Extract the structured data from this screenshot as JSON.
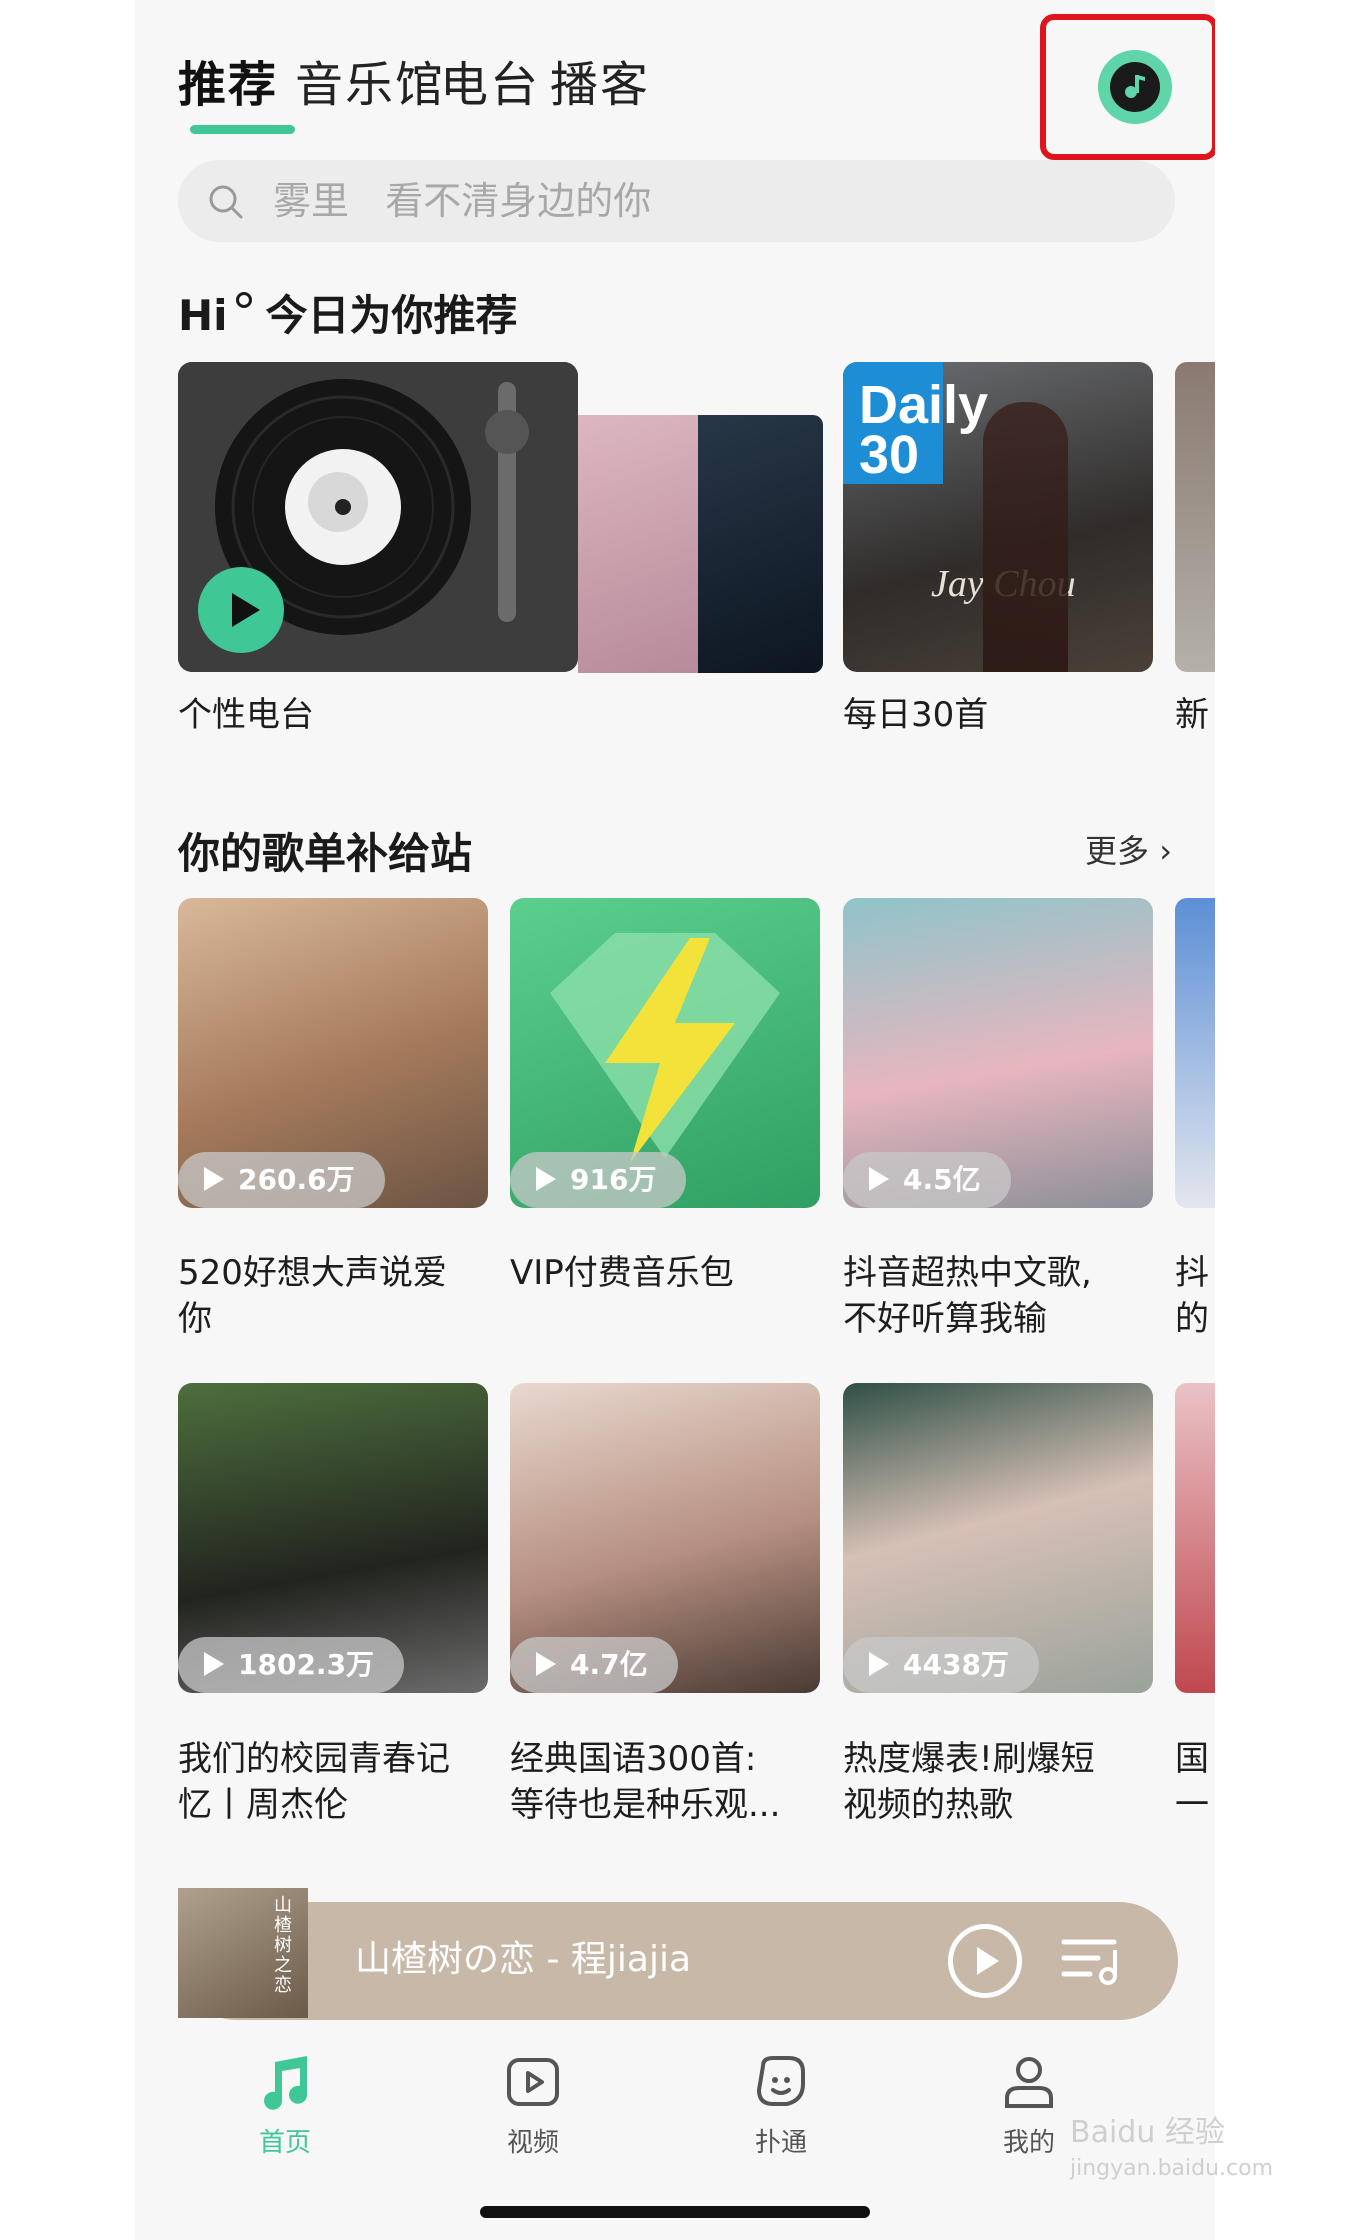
{
  "tabs": [
    {
      "label": "推荐",
      "active": true
    },
    {
      "label": "音乐馆",
      "active": false
    },
    {
      "label": "电台",
      "active": false
    },
    {
      "label": "播客",
      "active": false
    }
  ],
  "search": {
    "placeholder": "雾里   看不清身边的你"
  },
  "recommend": {
    "title": "Hi",
    "subtitle": "今日为你推荐",
    "cards": [
      {
        "label": "个性电台"
      },
      {
        "label": "每日30首",
        "cover_text_1": "Daily",
        "cover_text_2": "30",
        "cover_text_3": "Jay Chou"
      },
      {
        "label": "新"
      }
    ]
  },
  "playlists": {
    "title": "你的歌单补给站",
    "more_label": "更多",
    "rows": [
      [
        {
          "plays": "260.6万",
          "title_line1": "520好想大声说爱",
          "title_line2": "你"
        },
        {
          "plays": "916万",
          "title_line1": "VIP付费音乐包",
          "title_line2": ""
        },
        {
          "plays": "4.5亿",
          "title_line1": "抖音超热中文歌,",
          "title_line2": "不好听算我输"
        },
        {
          "plays": "",
          "title_line1": "抖",
          "title_line2": "的"
        }
      ],
      [
        {
          "plays": "1802.3万",
          "title_line1": "我们的校园青春记",
          "title_line2": "忆丨周杰伦"
        },
        {
          "plays": "4.7亿",
          "title_line1": "经典国语300首:",
          "title_line2": "等待也是种乐观..."
        },
        {
          "plays": "4438万",
          "title_line1": "热度爆表!刷爆短",
          "title_line2": "视频的热歌"
        },
        {
          "plays": "",
          "title_line1": "国",
          "title_line2": "一"
        }
      ]
    ]
  },
  "player": {
    "now_playing": "山楂树の恋 - 程jiajia",
    "cover_text": "山楂树之恋"
  },
  "bottom_nav": [
    {
      "label": "首页",
      "icon": "music-note-icon",
      "active": true
    },
    {
      "label": "视频",
      "icon": "video-icon",
      "active": false
    },
    {
      "label": "扑通",
      "icon": "chat-bubble-icon",
      "active": false
    },
    {
      "label": "我的",
      "icon": "profile-icon",
      "active": false
    }
  ],
  "watermark": {
    "line1": "Baidu 经验",
    "line2": "jingyan.baidu.com"
  },
  "colors": {
    "accent": "#3fc796",
    "highlight_frame": "#e0141c",
    "player_bg": "#c8b8a8"
  }
}
